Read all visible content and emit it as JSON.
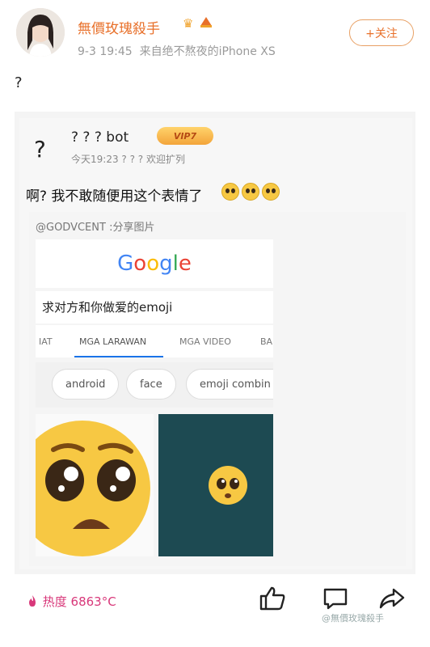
{
  "header": {
    "username": "無價玫瑰殺手",
    "badges": [
      "crown-icon",
      "cake-icon"
    ],
    "timestamp": "9-3 19:45",
    "source": "来自绝不熬夜的iPhone XS",
    "follow_label": "+关注"
  },
  "post": {
    "text": "?"
  },
  "repost": {
    "avatar_text": "?",
    "name": "? ? ? bot",
    "vip_label": "VIP7",
    "meta": "今天19:23  ? ? ? 欢迎扩列",
    "caption": "啊? 我不敢随便用这个表情了",
    "screenshot": {
      "source": "@GODVCENT :分享图片",
      "logo": "Google",
      "query": "求对方和你做爱的emoji",
      "tabs": [
        "IAT",
        "MGA LARAWAN",
        "MGA VIDEO",
        "BA"
      ],
      "active_tab": "MGA LARAWAN",
      "chips": [
        "android",
        "face",
        "emoji combin"
      ]
    }
  },
  "footer": {
    "heat": "热度 6863°C",
    "watermark": "@無價玫瑰殺手"
  },
  "colors": {
    "accent": "#e8702a",
    "heat": "#d8387a",
    "emoji_yellow": "#f7c843",
    "teal_image": "#1d4a52"
  }
}
